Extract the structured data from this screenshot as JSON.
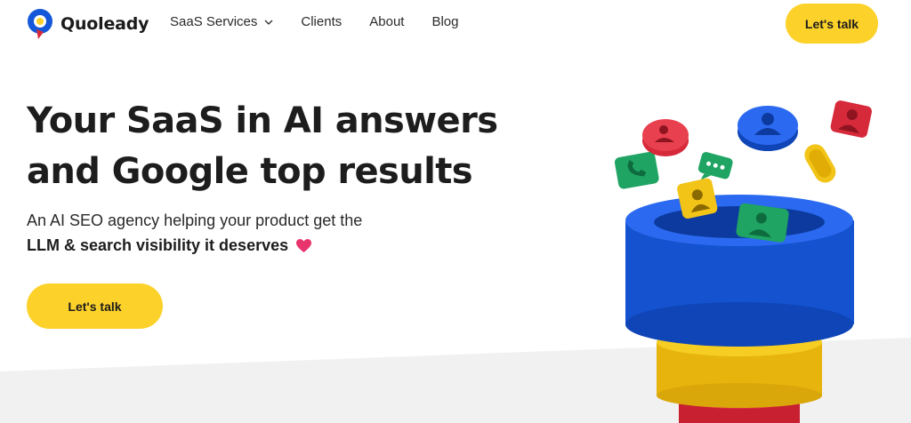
{
  "brand": {
    "name": "Quoleady"
  },
  "nav": {
    "items": [
      {
        "label": "SaaS Services",
        "has_dropdown": true
      },
      {
        "label": "Clients"
      },
      {
        "label": "About"
      },
      {
        "label": "Blog"
      }
    ],
    "cta_label": "Let's talk"
  },
  "hero": {
    "title_line1": "Your SaaS in AI answers",
    "title_line2": "and Google top results",
    "subtitle": "An AI SEO agency helping your product get the",
    "subtitle_strong": "LLM & search visibility it deserves",
    "cta_label": "Let's talk"
  },
  "colors": {
    "accent_yellow": "#fcd22a",
    "funnel_blue": "#1457d9",
    "funnel_yellow": "#f2c417",
    "funnel_red": "#d6293a",
    "icon_green": "#1fa463",
    "heart_pink": "#e8336d",
    "band_grey": "#f1f1f1"
  },
  "icons": [
    "quoleady-logo-icon",
    "chevron-down-icon",
    "heart-icon",
    "funnel-illustration"
  ]
}
